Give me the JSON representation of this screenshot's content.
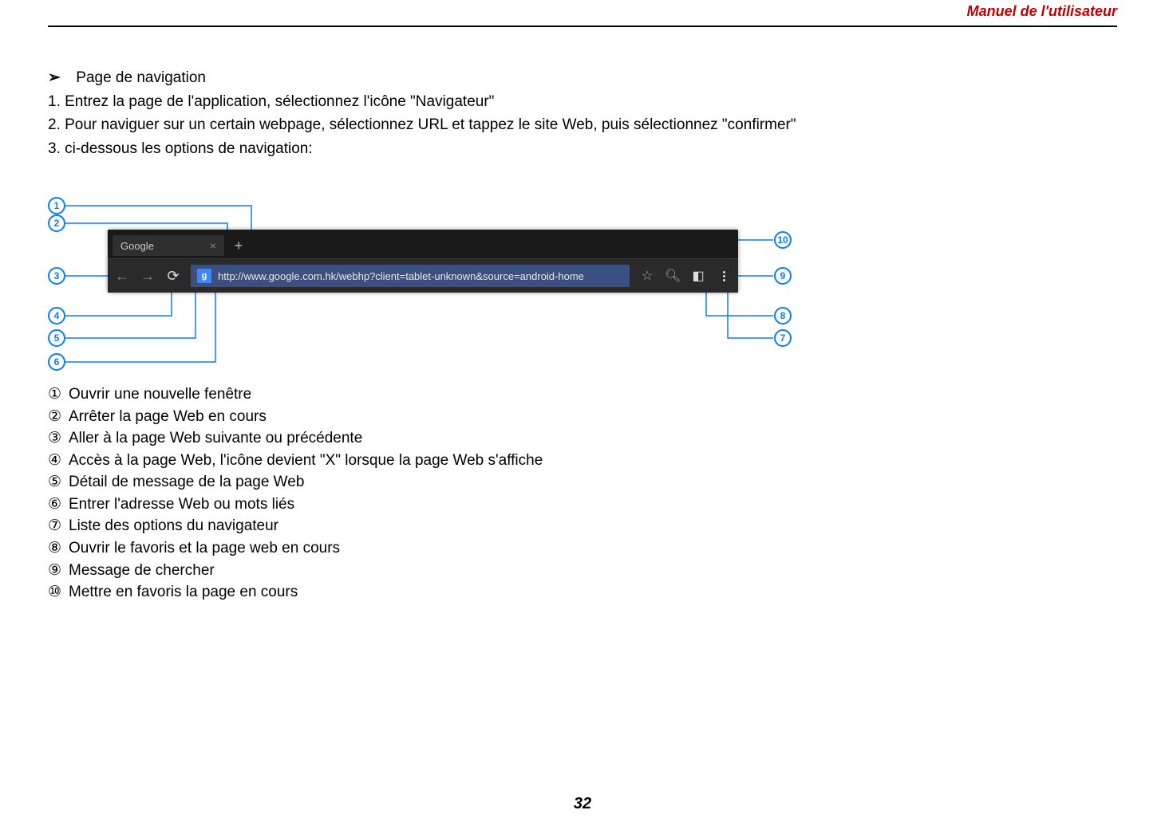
{
  "header": {
    "title": "Manuel de l'utilisateur"
  },
  "section": {
    "heading": "Page de navigation",
    "steps": [
      "1. Entrez la page de l'application, sélectionnez l'icône \"Navigateur\"",
      "2. Pour naviguer sur un certain webpage, sélectionnez URL et tappez le site Web, puis sélectionnez \"confirmer\"",
      "3. ci-dessous les options de navigation:"
    ]
  },
  "browser": {
    "tab_label": "Google",
    "url": "http://www.google.com.hk/webhp?client=tablet-unknown&source=android-home",
    "site_badge": "g"
  },
  "callouts": {
    "n1": "1",
    "n2": "2",
    "n3": "3",
    "n4": "4",
    "n5": "5",
    "n6": "6",
    "n7": "7",
    "n8": "8",
    "n9": "9",
    "n10": "10"
  },
  "legend": {
    "items": [
      {
        "mark": "①",
        "text": "Ouvrir une nouvelle fenêtre"
      },
      {
        "mark": "②",
        "text": "Arrêter la page Web en cours"
      },
      {
        "mark": "③",
        "text": "Aller à la page Web suivante ou précédente"
      },
      {
        "mark": "④",
        "text": "Accès à la page Web, l'icône devient \"X\" lorsque la page Web s'affiche"
      },
      {
        "mark": "⑤",
        "text": "Détail de message de la page Web"
      },
      {
        "mark": "⑥",
        "text": "Entrer l'adresse Web ou mots liés"
      },
      {
        "mark": "⑦",
        "text": "Liste des options du navigateur"
      },
      {
        "mark": "⑧",
        "text": "Ouvrir le favoris et la page web en cours"
      },
      {
        "mark": "⑨",
        "text": "Message de chercher"
      },
      {
        "mark": "⑩",
        "text": "Mettre en favoris la page en cours"
      }
    ]
  },
  "page_number": "32"
}
